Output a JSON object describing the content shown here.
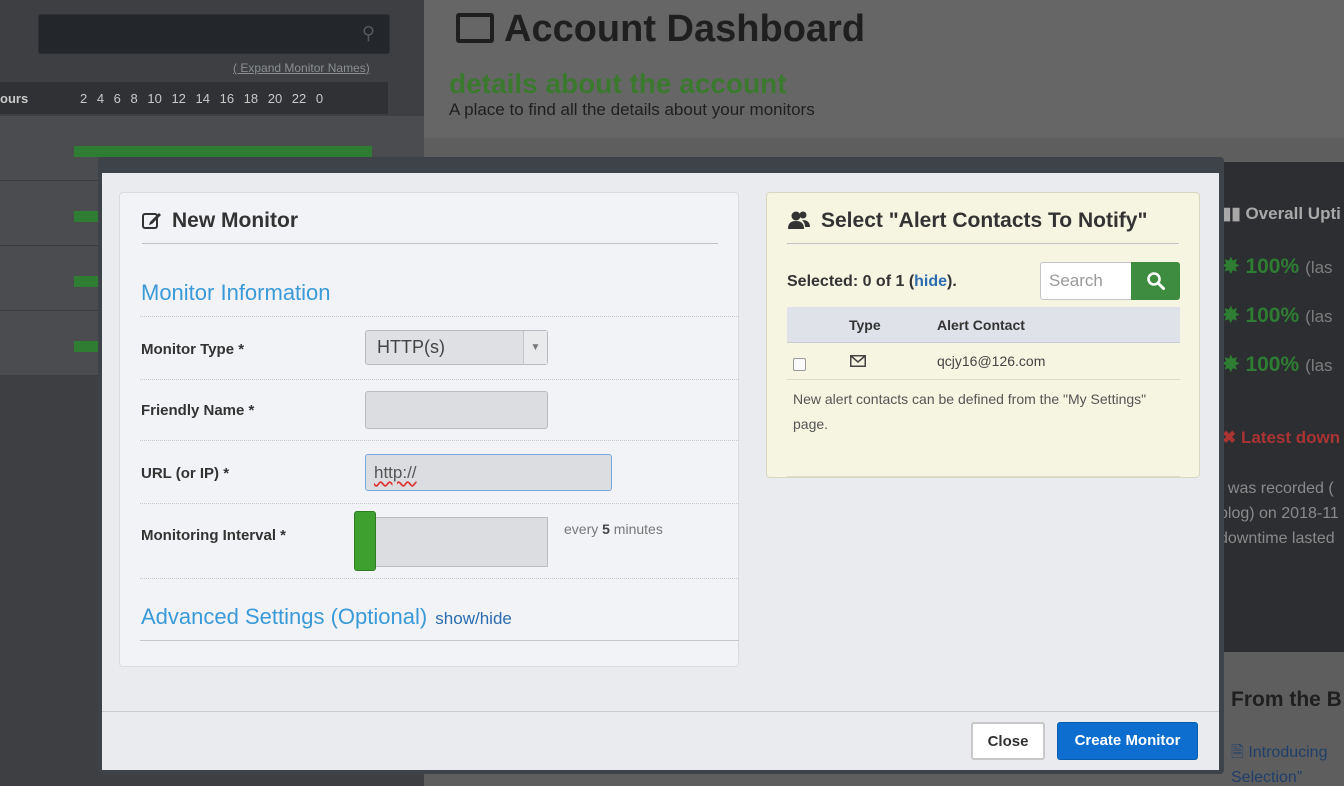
{
  "background": {
    "expand_prefix": "( ",
    "expand_link": "Expand Monitor Names",
    "expand_suffix": ")",
    "hours_label": "ours",
    "hours": "2 4 6 8 10 12 14 16 18 20 22 0",
    "title": "Account Dashboard",
    "subtitle": "details about the account",
    "description": "A place to find all the details about your monitors",
    "overall_uptime": "Overall Upti",
    "uptimes": [
      {
        "value": "100%",
        "suffix": "(las"
      },
      {
        "value": "100%",
        "suffix": "(las"
      },
      {
        "value": "100%",
        "suffix": "(las"
      }
    ],
    "latest_downtime": "Latest down",
    "downtime_lines": [
      "t was recorded (",
      "blog) on 2018-11",
      "downtime lasted"
    ],
    "from_blog": "From the B",
    "intro_line1": "Introducing",
    "intro_line2": "Selection”"
  },
  "modal": {
    "left": {
      "title": "New Monitor",
      "section_monitor_info": "Monitor Information",
      "monitor_type_label": "Monitor Type *",
      "monitor_type_value": "HTTP(s)",
      "friendly_name_label": "Friendly Name *",
      "friendly_name_value": "",
      "url_label": "URL (or IP) *",
      "url_value": "http://",
      "interval_label": "Monitoring Interval *",
      "interval_prefix": "every ",
      "interval_value": "5",
      "interval_suffix": " minutes",
      "advanced_title": "Advanced Settings (Optional)",
      "advanced_link": "show/hide"
    },
    "right": {
      "title": "Select \"Alert Contacts To Notify\"",
      "selected_prefix": "Selected: 0 of 1 (",
      "hide_link": "hide",
      "selected_suffix": ").",
      "search_placeholder": "Search",
      "col_type": "Type",
      "col_contact": "Alert Contact",
      "contacts": [
        {
          "type_icon": "mail-icon",
          "email": "qcjy16@126.com",
          "checked": false
        }
      ],
      "note": "New alert contacts can be defined from the \"My Settings\" page."
    },
    "footer": {
      "close_label": "Close",
      "create_label": "Create Monitor"
    }
  },
  "colors": {
    "accent_blue": "#0d6ecf",
    "section_blue": "#3a9ad9",
    "green": "#3ea12f",
    "search_green": "#3d8c3f"
  }
}
